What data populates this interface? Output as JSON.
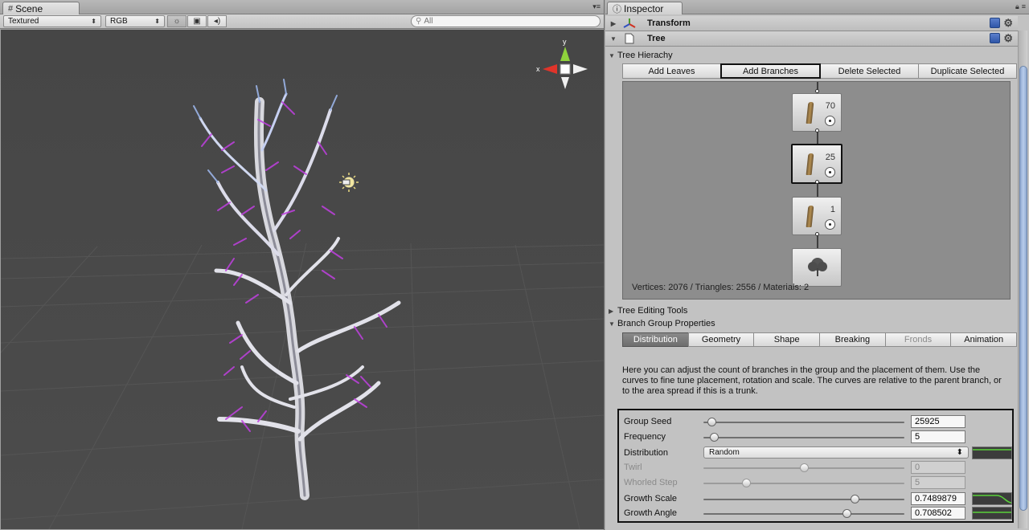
{
  "scene": {
    "tab_label": "Scene",
    "render_mode": "Textured",
    "color_mode": "RGB",
    "search_placeholder": "All",
    "gizmo": {
      "y_label": "y",
      "x_label": "x"
    },
    "icons": [
      "scene-tab-icon",
      "sun-lighting-icon",
      "image-icon",
      "audio-icon",
      "search-icon"
    ]
  },
  "inspector": {
    "tab_label": "Inspector",
    "components": [
      {
        "name": "Transform"
      },
      {
        "name": "Tree"
      }
    ],
    "tree_hierarchy": {
      "title": "Tree Hierachy",
      "buttons": [
        "Add Leaves",
        "Add Branches",
        "Delete Selected",
        "Duplicate Selected"
      ],
      "selected_button": "Add Branches",
      "nodes": [
        {
          "type": "branch",
          "count": "70"
        },
        {
          "type": "branch",
          "count": "25",
          "selected": true
        },
        {
          "type": "branch",
          "count": "1"
        },
        {
          "type": "root"
        }
      ],
      "stats": "Vertices: 2076 / Triangles: 2556 / Materials: 2"
    },
    "tree_editing_tools": {
      "title": "Tree Editing Tools"
    },
    "branch_group": {
      "title": "Branch Group Properties",
      "tabs": [
        "Distribution",
        "Geometry",
        "Shape",
        "Breaking",
        "Fronds",
        "Animation"
      ],
      "active_tab": "Distribution",
      "disabled_tab": "Fronds",
      "help": "Here you can adjust the count of branches in the group and the placement of them. Use the curves to fine tune placement, rotation and scale. The curves are relative to the parent branch, or to the area spread if this is a trunk.",
      "properties": [
        {
          "label": "Group Seed",
          "kind": "slider",
          "value": "25925",
          "fraction": 0.04,
          "enabled": true
        },
        {
          "label": "Frequency",
          "kind": "slider",
          "value": "5",
          "fraction": 0.05,
          "enabled": true
        },
        {
          "label": "Distribution",
          "kind": "dropdown",
          "value": "Random",
          "enabled": true,
          "curve": true
        },
        {
          "label": "Twirl",
          "kind": "slider",
          "value": "0",
          "fraction": 0.5,
          "enabled": false
        },
        {
          "label": "Whorled Step",
          "kind": "slider",
          "value": "5",
          "fraction": 0.21,
          "enabled": false
        },
        {
          "label": "Growth Scale",
          "kind": "slider",
          "value": "0.7489879",
          "fraction": 0.75,
          "enabled": true,
          "curve": true
        },
        {
          "label": "Growth Angle",
          "kind": "slider",
          "value": "0.708502",
          "fraction": 0.71,
          "enabled": true,
          "curve": true
        }
      ]
    }
  }
}
